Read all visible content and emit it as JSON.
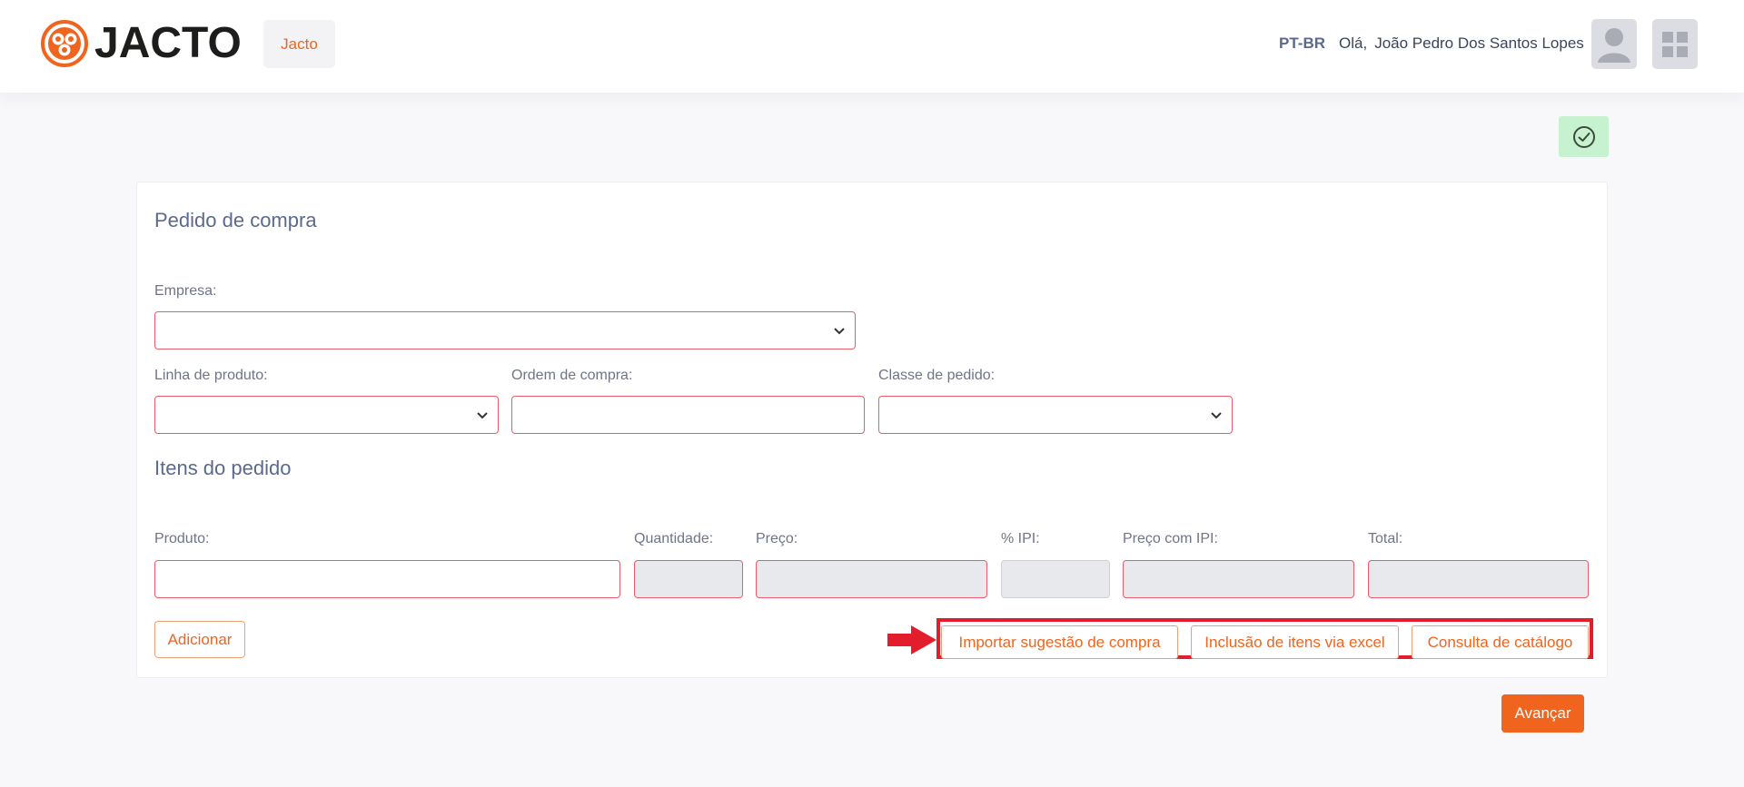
{
  "header": {
    "brand": "JACTO",
    "company": "Jacto",
    "language": "PT-BR",
    "greeting": "Olá,",
    "user_name": "João Pedro Dos Santos Lopes",
    "avatar_icon": "user-avatar-icon",
    "apps_icon": "grid-icon"
  },
  "status": {
    "icon": "check-circle-icon",
    "color": "#c6f2cf"
  },
  "order": {
    "title": "Pedido de compra",
    "company_label": "Empresa:",
    "company_value": "",
    "product_line_label": "Linha de produto:",
    "product_line_value": "",
    "purchase_order_label": "Ordem de compra:",
    "purchase_order_value": "",
    "order_class_label": "Classe de pedido:",
    "order_class_value": ""
  },
  "items": {
    "title": "Itens do pedido",
    "product_label": "Produto:",
    "quantity_label": "Quantidade:",
    "price_label": "Preço:",
    "ipi_label": "% IPI:",
    "price_ipi_label": "Preço com IPI:",
    "total_label": "Total:",
    "add_button": "Adicionar",
    "import_button": "Importar sugestão de compra",
    "excel_button": "Inclusão de itens via excel",
    "catalog_button": "Consulta de catálogo"
  },
  "footer": {
    "advance_button": "Avançar"
  },
  "colors": {
    "accent": "#f0641e",
    "field_border": "#e85d6a",
    "highlight": "#e31e2c"
  }
}
